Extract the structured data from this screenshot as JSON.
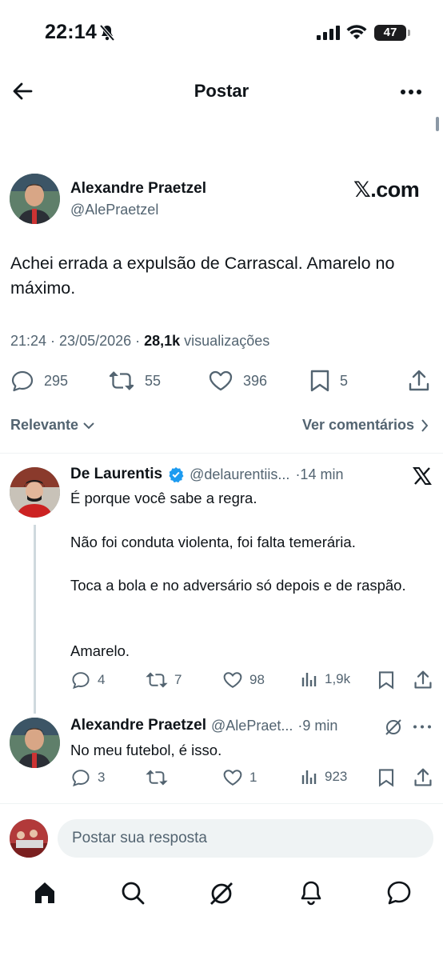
{
  "status_bar": {
    "time": "22:14",
    "battery": "47"
  },
  "header": {
    "title": "Postar"
  },
  "post": {
    "author_name": "Alexandre Praetzel",
    "author_handle": "@AlePraetzel",
    "brand": "𝕏.com",
    "text": "Achei errada a expulsão de Carrascal. Amarelo no máximo.",
    "timestamp": "21:24 · 23/05/2026 · ",
    "views_count": "28,1k",
    "views_label": " visualizações",
    "replies": "295",
    "reposts": "55",
    "likes": "396",
    "bookmarks": "5"
  },
  "sort": {
    "label": "Relevante",
    "see_comments": "Ver comentários"
  },
  "replies": [
    {
      "name": "De Laurentis",
      "handle": "@delaurentiis...",
      "time": "·14 min",
      "paragraphs": [
        "É porque você sabe a regra.",
        "Não foi conduta violenta, foi falta temerária.",
        "Toca a bola e no adversário só depois e de raspão.",
        "Amarelo."
      ],
      "replies": "4",
      "reposts": "7",
      "likes": "98",
      "views": "1,9k"
    },
    {
      "name": "Alexandre Praetzel",
      "handle": "@AlePraet...",
      "time": "·9 min",
      "paragraphs": [
        "No meu futebol, é isso."
      ],
      "replies": "3",
      "reposts": "",
      "likes": "1",
      "views": "923"
    }
  ],
  "compose": {
    "placeholder": "Postar sua resposta"
  },
  "colors": {
    "text": "#0f1419",
    "secondary": "#536471",
    "verified": "#1d9bf0",
    "divider": "#eff3f4"
  }
}
